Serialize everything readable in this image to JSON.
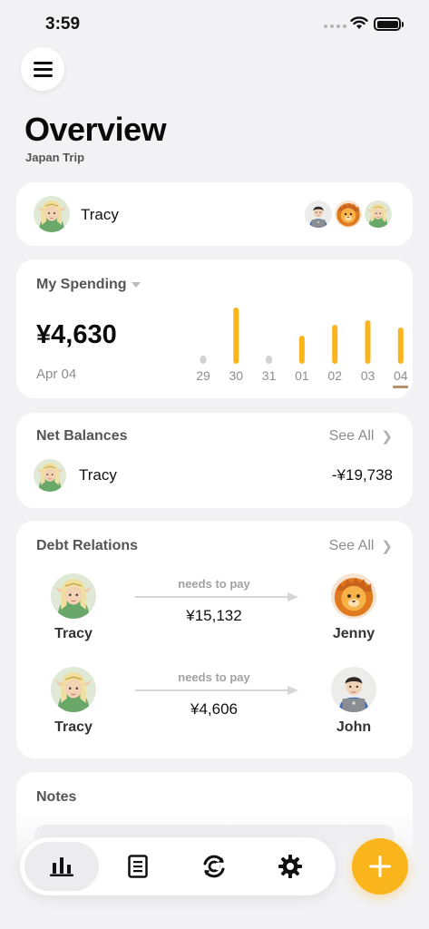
{
  "status_bar": {
    "time": "3:59"
  },
  "header": {
    "title": "Overview",
    "subtitle": "Japan Trip"
  },
  "trip": {
    "current_user": "Tracy",
    "member_avatars": [
      "john-avatar-icon",
      "jenny-lion-avatar-icon",
      "tracy-elf-avatar-icon"
    ]
  },
  "spending": {
    "title": "My Spending",
    "amount": "¥4,630",
    "date": "Apr 04",
    "accent": "#fbb51c"
  },
  "chart_data": {
    "type": "bar",
    "categories": [
      "29",
      "30",
      "31",
      "01",
      "02",
      "03",
      "04"
    ],
    "values": [
      0,
      62,
      0,
      31,
      43,
      48,
      40
    ],
    "selected": "04"
  },
  "net_balances": {
    "title": "Net Balances",
    "see_all": "See All",
    "rows": [
      {
        "name": "Tracy",
        "value": "-¥19,738"
      }
    ]
  },
  "debt_relations": {
    "title": "Debt Relations",
    "see_all": "See All",
    "relations": [
      {
        "from": "Tracy",
        "label": "needs to pay",
        "amount": "¥15,132",
        "to": "Jenny"
      },
      {
        "from": "Tracy",
        "label": "needs to pay",
        "amount": "¥4,606",
        "to": "John"
      }
    ]
  },
  "notes": {
    "title": "Notes"
  },
  "tabbar": {
    "tabs": [
      "overview-chart-icon",
      "receipt-list-icon",
      "currency-exchange-icon",
      "settings-gear-icon"
    ],
    "active": 0
  },
  "colors": {
    "accent": "#fbb51c",
    "background": "#f2f2f4"
  }
}
